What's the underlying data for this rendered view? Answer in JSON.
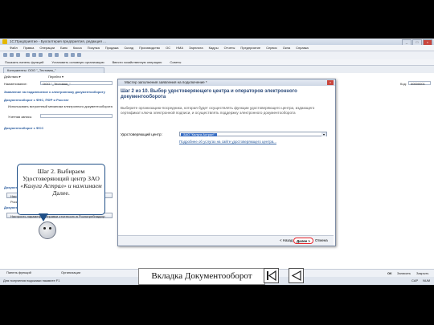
{
  "window": {
    "title": "1С:Предприятие - Бухгалтерия предприятия, редакция ...",
    "controls": [
      "_",
      "□",
      "×"
    ]
  },
  "menu": [
    "Файл",
    "Правка",
    "Операции",
    "Банк",
    "Касса",
    "Покупка",
    "Продажа",
    "Склад",
    "Производство",
    "ОС",
    "НМА",
    "Зарплата",
    "Кадры",
    "Отчеты",
    "Предприятие",
    "Сервис",
    "Окна",
    "Справка"
  ],
  "funcbar": [
    "Показать панель функций",
    "Установить основную организацию",
    "Ввести хозяйственную операцию",
    "Советы"
  ],
  "doc_tab": "Контрагенты: ООО \"_Тестовая_\"",
  "form": {
    "actions_label": "Действия ▾",
    "go_label": "Перейти ▾",
    "name_label": "Наименование:",
    "name_value": "ООО \"_Тестовая_\"",
    "code_label": "Код:",
    "code_value": "00000001",
    "section1": "Заявление на подключение к электронному документообороту",
    "section2": "Документооборот с ФНС, ПФР и Росстат",
    "check1": "Использовать встроенный механизм электронного документооборота",
    "field_label": "Учетная запись:",
    "section3": "Документооборот с ФСС",
    "section4": "Документооборот с Росалкогольрегулированием",
    "btn1": "Настроить параметры отправки отчетности в Росалкогольрегулирование",
    "section5": "Документооборот с Роспотребнадзором",
    "btn2": "Настроить параметры отправки отчетности в Роспотребнадзор",
    "ok": "ОК",
    "save": "Записать",
    "close": "Закрыть"
  },
  "status": {
    "hint": "Для получения подсказки нажмите F1",
    "tab1": "Панель функций",
    "tab2": "Организации",
    "caps": "CAP",
    "num": "NUM"
  },
  "wizard": {
    "title": "Мастер заполнения заявления на подключение *",
    "heading": "Шаг 2 из 10. Выбор удостоверяющего центра и операторов электронного документооборота",
    "description": "Выберите организацию-посредника, которая будет осуществлять функции удостоверяющего центра, издающего сертификат ключа электронной подписи, и осуществлять поддержку электронного документооборота",
    "ca_label": "Удостоверяющий центр:",
    "ca_value": "ЗАО \"Калуга Астрал\"",
    "ca_link": "Подробнее об услугах на сайте удостоверяющего центра...",
    "back": "< Назад",
    "next": "Далее >",
    "cancel": "Отмена"
  },
  "callout": {
    "line1": "Шаг 2. Выбираем",
    "line2": "Удостоверяющий центр ЗАО",
    "line3": "«Калуга Астрал» и нажимаем",
    "line4": "Далее."
  },
  "caption": "Вкладка Документооборот",
  "nav": {
    "first_icon": "skip-to-first-icon",
    "back_icon": "back-triangle-icon"
  }
}
